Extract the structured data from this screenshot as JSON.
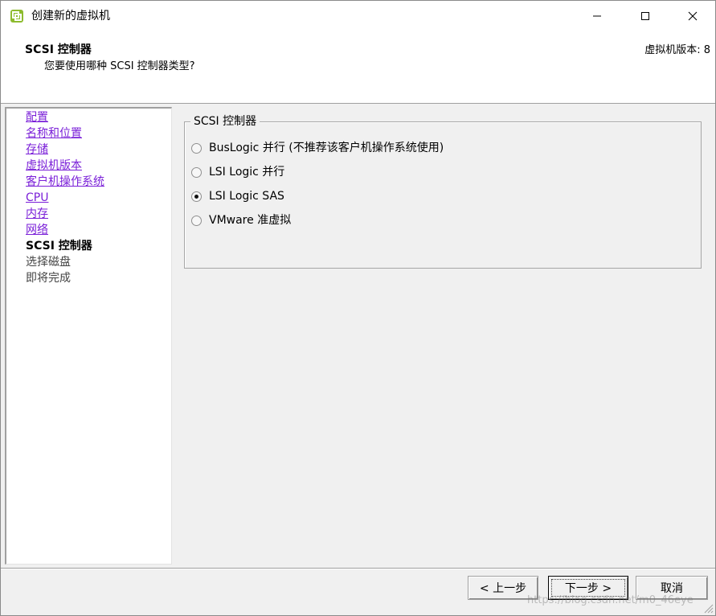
{
  "window": {
    "title": "创建新的虚拟机",
    "controls": [
      "minimize",
      "maximize",
      "close"
    ]
  },
  "header": {
    "title": "SCSI 控制器",
    "subtitle": "您要使用哪种 SCSI 控制器类型?",
    "version": "虚拟机版本: 8"
  },
  "nav": {
    "items": [
      {
        "label": "配置",
        "state": "link"
      },
      {
        "label": "名称和位置",
        "state": "link"
      },
      {
        "label": "存储",
        "state": "link"
      },
      {
        "label": "虚拟机版本",
        "state": "link"
      },
      {
        "label": "客户机操作系统",
        "state": "link"
      },
      {
        "label": "CPU",
        "state": "link"
      },
      {
        "label": "内存",
        "state": "link"
      },
      {
        "label": "网络",
        "state": "link"
      },
      {
        "label": "SCSI 控制器",
        "state": "current"
      },
      {
        "label": "选择磁盘",
        "state": "future"
      },
      {
        "label": "即将完成",
        "state": "future"
      }
    ]
  },
  "controller_group": {
    "legend": "SCSI 控制器",
    "options": [
      {
        "label": "BusLogic 并行 (不推荐该客户机操作系统使用)",
        "selected": false
      },
      {
        "label": "LSI Logic 并行",
        "selected": false
      },
      {
        "label": "LSI Logic SAS",
        "selected": true
      },
      {
        "label": "VMware 准虚拟",
        "selected": false
      }
    ]
  },
  "buttons": {
    "back": "< 上一步",
    "next": "下一步 >",
    "cancel": "取消"
  },
  "watermark": "https://blog.csdn.net/m0_46eye",
  "colors": {
    "link": "#7a1fd8",
    "background": "#f0f0f0",
    "panel": "#ffffff"
  }
}
